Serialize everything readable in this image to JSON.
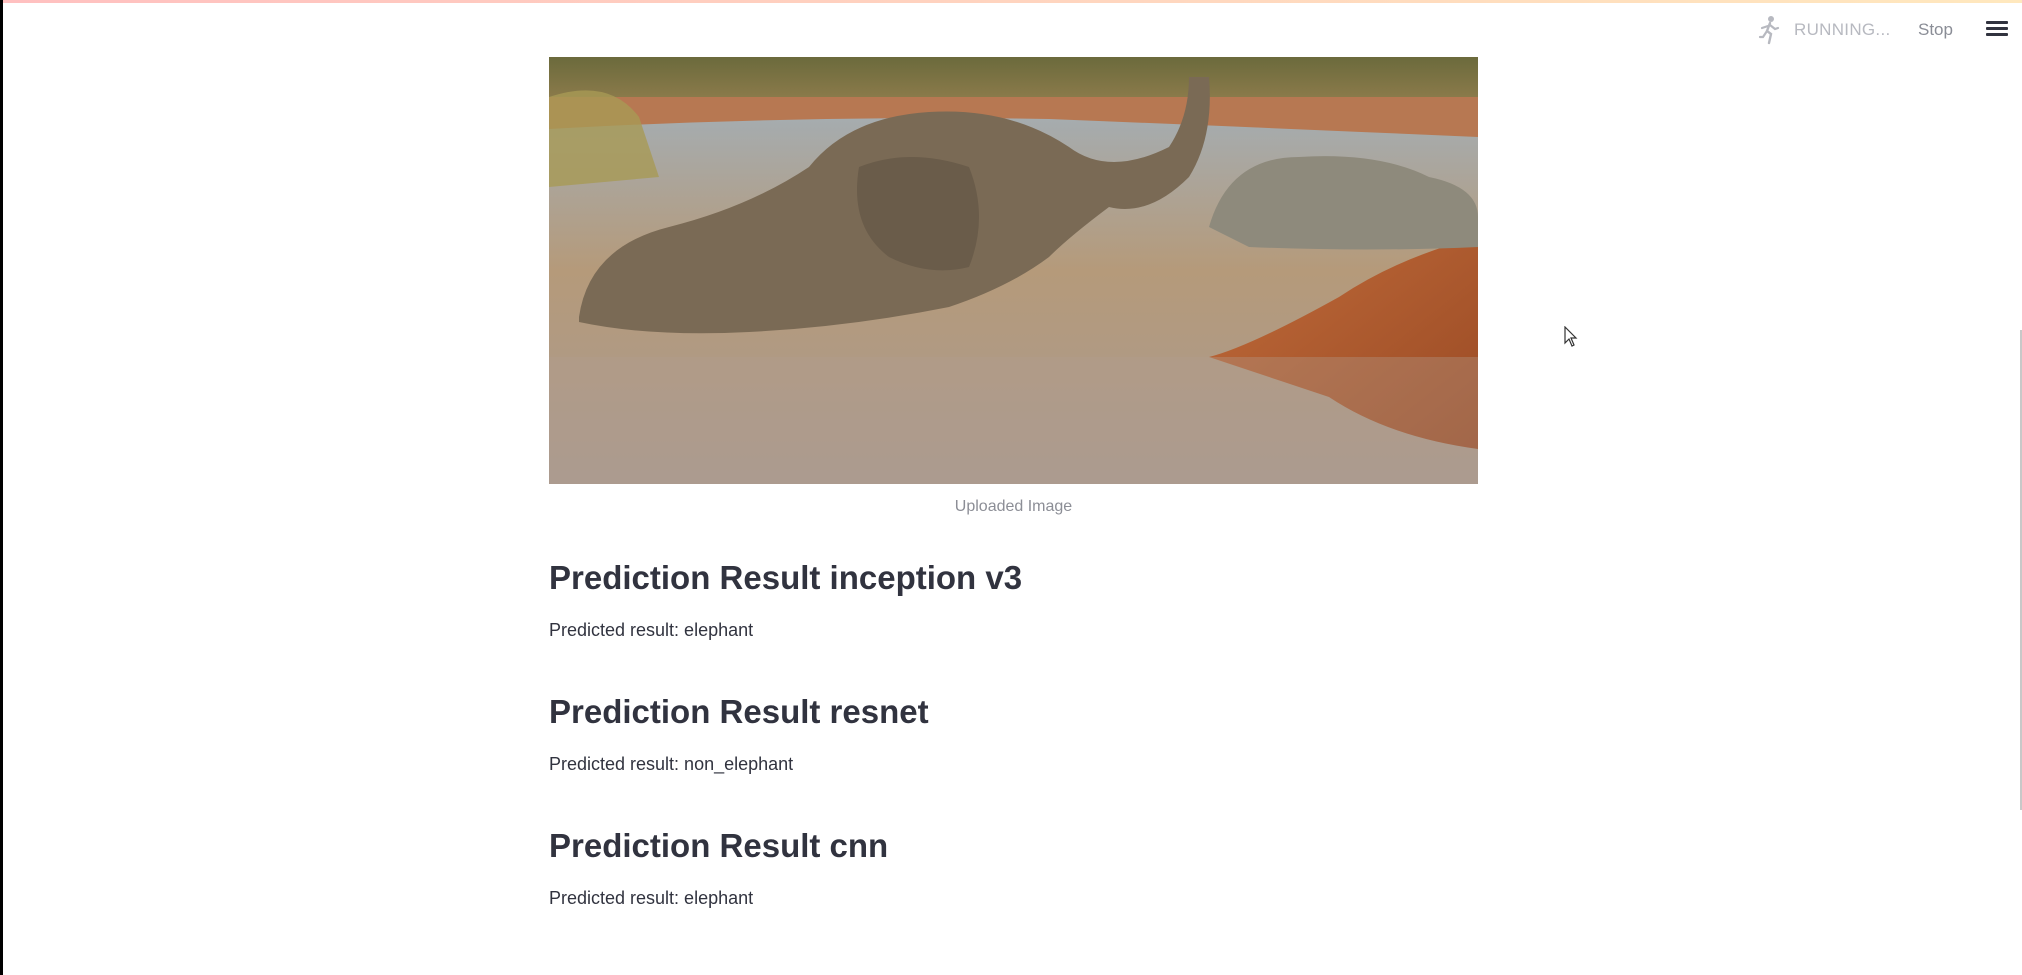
{
  "header": {
    "running_icon": "running-person-icon",
    "running_label": "RUNNING...",
    "stop_label": "Stop",
    "menu_icon": "hamburger-menu-icon"
  },
  "image": {
    "description_icon": "elephant-photo",
    "caption": "Uploaded Image"
  },
  "results": [
    {
      "heading": "Prediction Result inception v3",
      "text": "Predicted result: elephant"
    },
    {
      "heading": "Prediction Result resnet",
      "text": "Predicted result: non_elephant"
    },
    {
      "heading": "Prediction Result cnn",
      "text": "Predicted result: elephant"
    }
  ],
  "colors": {
    "text": "#31333f",
    "caption": "#8c8e96",
    "running": "#b7b9c0"
  }
}
